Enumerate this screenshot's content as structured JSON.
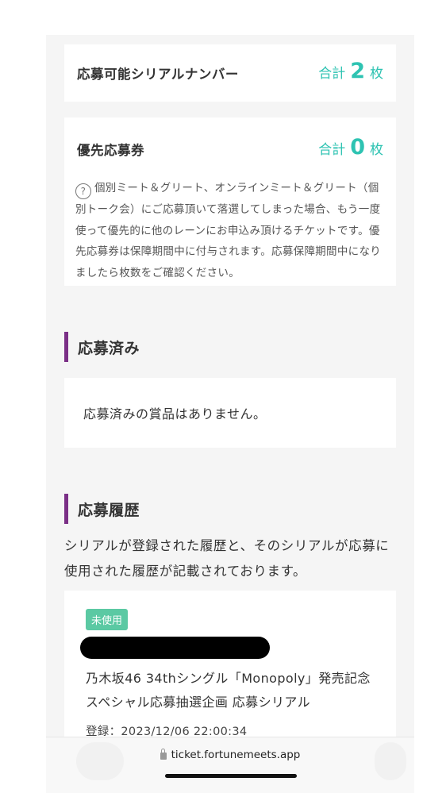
{
  "serials": {
    "title": "応募可能シリアルナンバー",
    "total_label": "合計",
    "total_count": "2",
    "unit": "枚"
  },
  "priority": {
    "title": "優先応募券",
    "total_label": "合計",
    "total_count": "0",
    "unit": "枚",
    "help_icon": "?",
    "note": "個別ミート＆グリート、オンラインミート＆グリート（個別トーク会）にご応募頂いて落選してしまった場合、もう一度使って優先的に他のレーンにお申込み頂けるチケットです。優先応募券は保障期間中に付与されます。応募保障期間中になりましたら枚数をご確認ください。"
  },
  "applied": {
    "heading": "応募済み",
    "empty_text": "応募済みの賞品はありません。"
  },
  "history": {
    "heading": "応募履歴",
    "description": "シリアルが登録された履歴と、そのシリアルが応募に使用された履歴が記載されております。",
    "items": [
      {
        "status": "未使用",
        "title": "乃木坂46 34thシングル「Monopoly」発売記念 スペシャル応募抽選企画 応募シリアル",
        "registered": "登録：2023/12/06 22:00:34"
      }
    ]
  },
  "browser": {
    "url": "ticket.fortunemeets.app",
    "lock_icon": "lock-icon"
  },
  "colors": {
    "accent_teal": "#2ec3b2",
    "heading_bar": "#7a2f86",
    "badge_green": "#5bc9a3"
  }
}
